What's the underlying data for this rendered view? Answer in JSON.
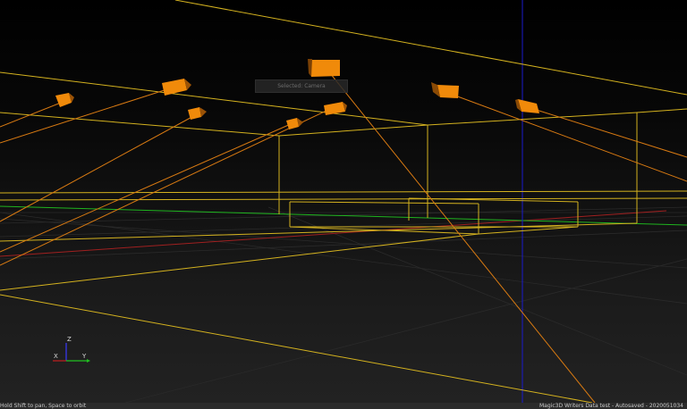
{
  "viewport": {
    "camera_label": "Selected: Camera"
  },
  "axes_gizmo": {
    "z_label": "Z",
    "x_label": "X",
    "y_label": "Y"
  },
  "status_bar": {
    "left_text": "Hold Shift to pan, Space to orbit",
    "right_text": "Magic3D Writers Data test - Autosaved - 2020051034"
  },
  "colors": {
    "background": "#000000",
    "wire": "#d4b21f",
    "camera": "#f08a0a",
    "ray": "#d87a12",
    "axis_x": "#a02020",
    "axis_y": "#1fb41f",
    "axis_z": "#1a1acc",
    "statusbar_bg": "#2b2b2b"
  },
  "icons": {
    "camera": "camera-box-icon"
  }
}
